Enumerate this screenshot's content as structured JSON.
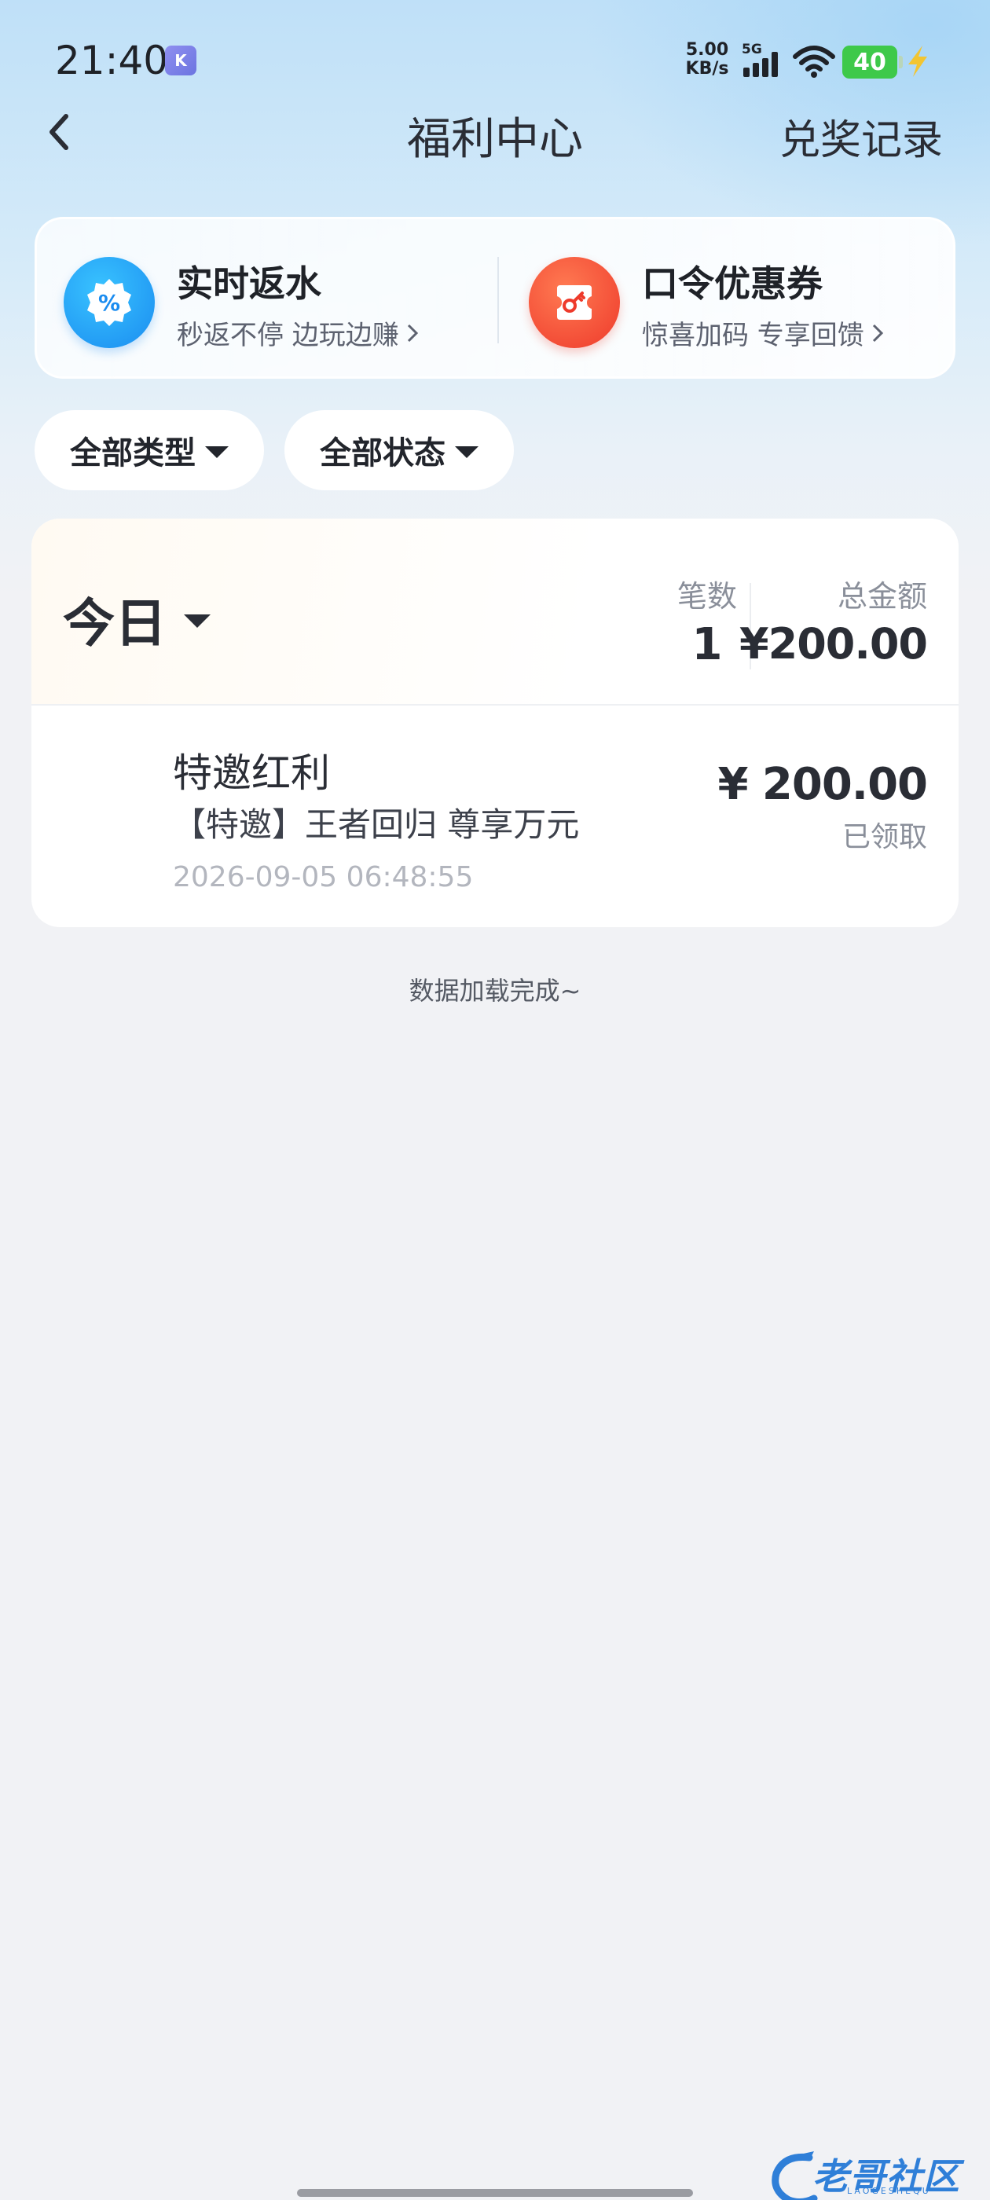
{
  "status_bar": {
    "time": "21:40",
    "app_badge": "K",
    "net_speed_value": "5.00",
    "net_speed_unit": "KB/s",
    "network": "5G",
    "battery": "40"
  },
  "nav": {
    "title": "福利中心",
    "right_link": "兑奖记录",
    "back_icon": "chevron-left-icon"
  },
  "promos": [
    {
      "title": "实时返水",
      "subtitle": "秒返不停 边玩边赚",
      "icon": "percent-badge-icon",
      "color": "#1a8cf0"
    },
    {
      "title": "口令优惠券",
      "subtitle": "惊喜加码 专享回馈",
      "icon": "key-ticket-icon",
      "color": "#ee3a2b"
    }
  ],
  "filters": {
    "type_label": "全部类型",
    "status_label": "全部状态"
  },
  "summary": {
    "period": "今日",
    "count_label": "笔数",
    "count_value": "1",
    "amount_label": "总金额",
    "amount_value": "¥200.00"
  },
  "records": [
    {
      "title": "特邀红利",
      "description": "【特邀】王者回归 尊享万元",
      "time": "2026-09-05 06:48:55",
      "amount": "¥ 200.00",
      "status": "已领取"
    }
  ],
  "footer": {
    "load_done": "数据加载完成~"
  },
  "watermark": {
    "text": "老哥社区",
    "sub": "LAOGESHEQU"
  }
}
